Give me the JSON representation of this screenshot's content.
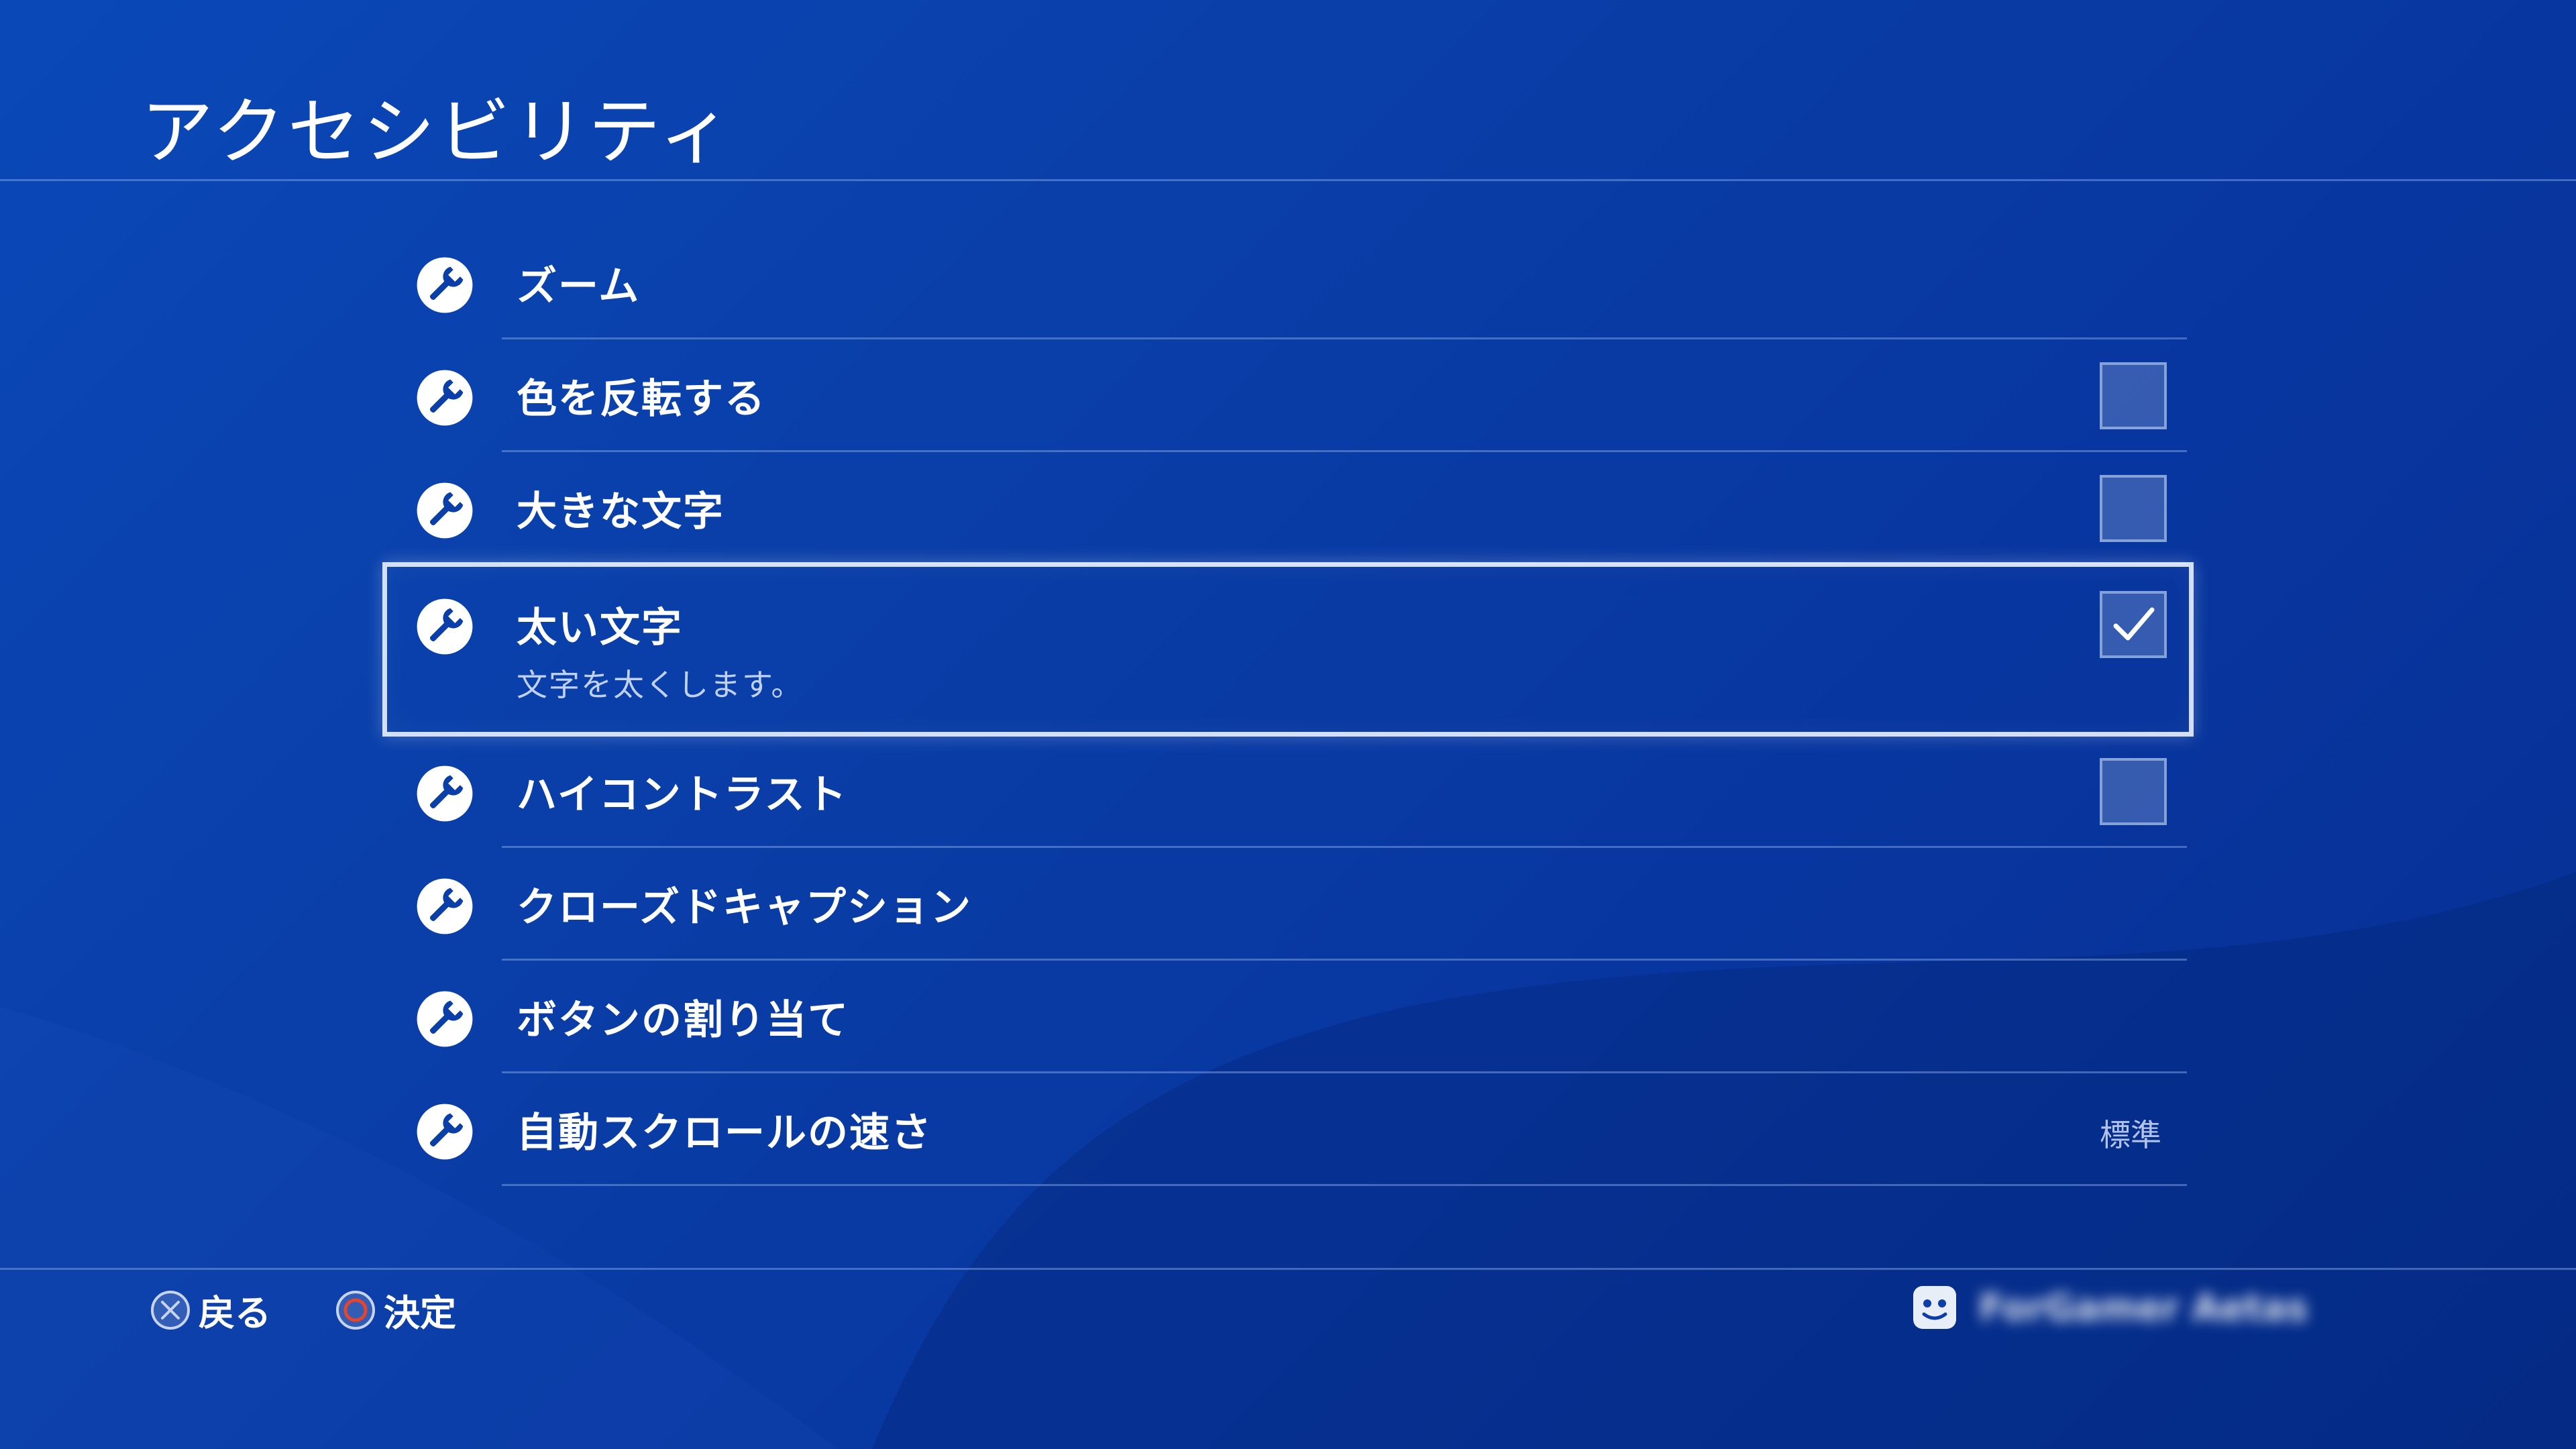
{
  "header": {
    "title": "アクセシビリティ"
  },
  "menu": {
    "items": [
      {
        "label": "ズーム",
        "icon": "wrench-icon",
        "control": "none"
      },
      {
        "label": "色を反転する",
        "icon": "wrench-icon",
        "control": "checkbox",
        "checked": false
      },
      {
        "label": "大きな文字",
        "icon": "wrench-icon",
        "control": "checkbox",
        "checked": false
      },
      {
        "label": "太い文字",
        "sublabel": "文字を太くします。",
        "icon": "wrench-icon",
        "control": "checkbox",
        "checked": true,
        "selected": true
      },
      {
        "label": "ハイコントラスト",
        "icon": "wrench-icon",
        "control": "checkbox",
        "checked": false
      },
      {
        "label": "クローズドキャプション",
        "icon": "wrench-icon",
        "control": "none"
      },
      {
        "label": "ボタンの割り当て",
        "icon": "wrench-icon",
        "control": "none"
      },
      {
        "label": "自動スクロールの速さ",
        "icon": "wrench-icon",
        "control": "value",
        "value": "標準"
      }
    ]
  },
  "footer": {
    "back_label": "戻る",
    "back_icon": "cross-button-icon",
    "confirm_label": "決定",
    "confirm_icon": "circle-button-icon",
    "user_icon": "avatar-icon",
    "username": "ForGamer Aetas"
  },
  "colors": {
    "background": "#0a3ea8",
    "divider": "#6f8fd0",
    "checkbox_fill": "#4a6cb8",
    "circle_button": "#e8442a"
  }
}
